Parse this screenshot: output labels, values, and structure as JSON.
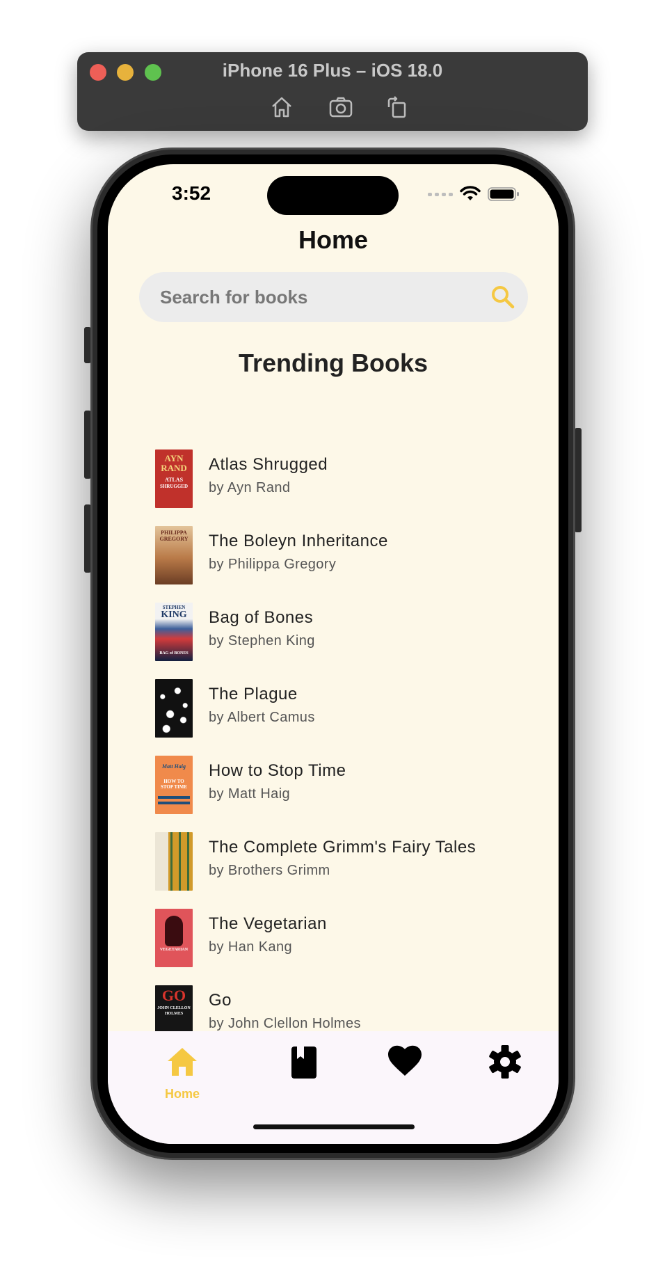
{
  "simulator": {
    "title": "iPhone 16 Plus – iOS 18.0",
    "tools": [
      "home-icon",
      "screenshot-icon",
      "rotate-icon"
    ]
  },
  "status_bar": {
    "time": "3:52"
  },
  "header": {
    "title": "Home"
  },
  "search": {
    "placeholder": "Search for books",
    "value": ""
  },
  "section": {
    "title": "Trending Books"
  },
  "books": [
    {
      "title": "Atlas Shrugged",
      "author": "by Ayn Rand",
      "cover_color": "#c0312b"
    },
    {
      "title": "The Boleyn Inheritance",
      "author": "by Philippa Gregory",
      "cover_color": "#c9a070"
    },
    {
      "title": "Bag of Bones",
      "author": "by Stephen King",
      "cover_color": "#1f3a66"
    },
    {
      "title": "The Plague",
      "author": "by Albert Camus",
      "cover_color": "#111111"
    },
    {
      "title": "How to Stop Time",
      "author": "by Matt Haig",
      "cover_color": "#f08a4b"
    },
    {
      "title": "The Complete Grimm's Fairy Tales",
      "author": "by Brothers Grimm",
      "cover_color": "#d19a2a"
    },
    {
      "title": "The Vegetarian",
      "author": "by Han Kang",
      "cover_color": "#e0545a"
    },
    {
      "title": "Go",
      "author": "by John Clellon Holmes",
      "cover_color": "#151515"
    }
  ],
  "cover_lettering": {
    "atlas": [
      "AYN",
      "RAND",
      "ATLAS",
      "SHRUGGED"
    ],
    "boleyn": [
      "PHILIPPA",
      "GREGORY"
    ],
    "bones": [
      "STEPHEN",
      "KING",
      "BAG of BONES"
    ],
    "haig": [
      "Matt Haig",
      "HOW TO",
      "STOP TIME"
    ],
    "vegetarian": [
      "VEGETARIAN"
    ],
    "go": [
      "GO",
      "JOHN CLELLON",
      "HOLMES"
    ]
  },
  "tab_bar": {
    "items": [
      {
        "label": "Home",
        "icon": "home-icon",
        "active": true
      },
      {
        "label": "",
        "icon": "book-icon",
        "active": false
      },
      {
        "label": "",
        "icon": "heart-icon",
        "active": false
      },
      {
        "label": "",
        "icon": "settings-gear-icon",
        "active": false
      }
    ]
  },
  "colors": {
    "accent": "#f5c842",
    "screen_background": "#fdf8e8",
    "tab_bar_background": "#fbf6fb",
    "search_background": "#ececec"
  }
}
